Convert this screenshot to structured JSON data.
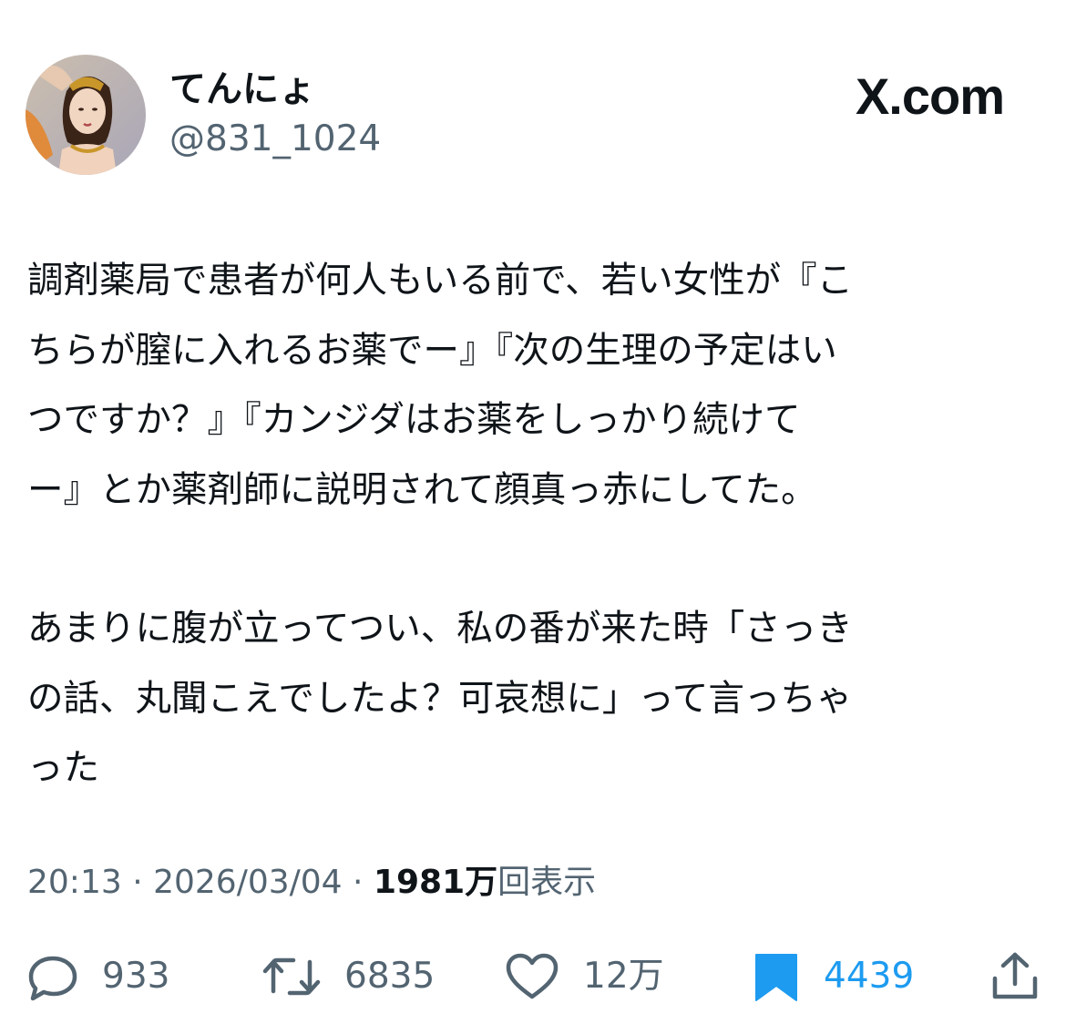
{
  "header": {
    "display_name": "てんにょ",
    "handle": "@831_1024",
    "brand": "X.com"
  },
  "tweet": {
    "paragraph1": [
      "調剤薬局で患者が何人もいる前で、若い女性が『こ",
      "ちらが膣に入れるお薬でー』『次の生理の予定はい",
      "つですか？』『カンジダはお薬をしっかり続けて",
      "ー』とか薬剤師に説明されて顔真っ赤にしてた。"
    ],
    "paragraph2": [
      "あまりに腹が立ってつい、私の番が来た時「さっき",
      "の話、丸聞こえでしたよ？可哀想に」って言っちゃ",
      "った"
    ]
  },
  "meta": {
    "time": "20:13",
    "sep1": " · ",
    "date": "2026/03/04",
    "sep2": " · ",
    "views_count": "1981万",
    "views_label": "回表示"
  },
  "actions": {
    "replies": "933",
    "reposts": "6835",
    "likes": "12万",
    "bookmarks": "4439"
  },
  "colors": {
    "text": "#0f1419",
    "secondary": "#536471",
    "bookmark_accent": "#1d9bf0"
  },
  "icons": [
    "reply-icon",
    "repost-icon",
    "like-icon",
    "bookmark-icon",
    "share-icon"
  ]
}
